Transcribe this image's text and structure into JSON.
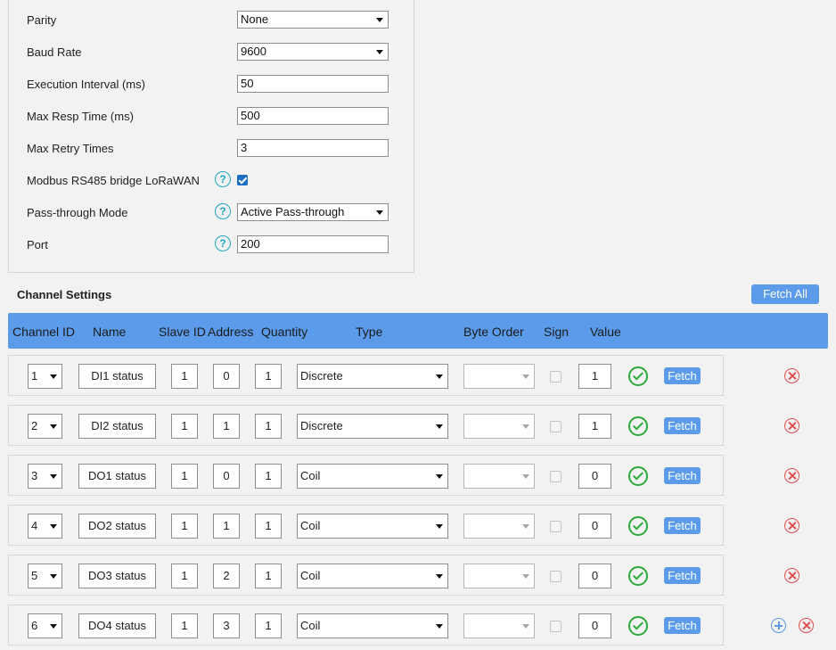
{
  "form": {
    "parity": {
      "label": "Parity",
      "value": "None"
    },
    "baud_rate": {
      "label": "Baud Rate",
      "value": "9600"
    },
    "execution_interval": {
      "label": "Execution Interval (ms)",
      "value": "50"
    },
    "max_resp_time": {
      "label": "Max Resp Time (ms)",
      "value": "500"
    },
    "max_retry_times": {
      "label": "Max Retry Times",
      "value": "3"
    },
    "bridge_lorawan": {
      "label": "Modbus RS485 bridge LoRaWAN",
      "checked": true
    },
    "pass_through_mode": {
      "label": "Pass-through Mode",
      "value": "Active Pass-through"
    },
    "port": {
      "label": "Port",
      "value": "200"
    },
    "help_glyph": "?"
  },
  "channel_settings": {
    "title": "Channel Settings",
    "fetch_all_label": "Fetch All",
    "fetch_label": "Fetch",
    "columns": [
      "Channel ID",
      "Name",
      "Slave ID",
      "Address",
      "Quantity",
      "Type",
      "Byte Order",
      "Sign",
      "Value"
    ],
    "rows": [
      {
        "channel_id": "1",
        "name": "DI1 status",
        "slave_id": "1",
        "address": "0",
        "quantity": "1",
        "type": "Discrete",
        "byte_order": "",
        "sign": false,
        "value": "1"
      },
      {
        "channel_id": "2",
        "name": "DI2 status",
        "slave_id": "1",
        "address": "1",
        "quantity": "1",
        "type": "Discrete",
        "byte_order": "",
        "sign": false,
        "value": "1"
      },
      {
        "channel_id": "3",
        "name": "DO1 status",
        "slave_id": "1",
        "address": "0",
        "quantity": "1",
        "type": "Coil",
        "byte_order": "",
        "sign": false,
        "value": "0"
      },
      {
        "channel_id": "4",
        "name": "DO2 status",
        "slave_id": "1",
        "address": "1",
        "quantity": "1",
        "type": "Coil",
        "byte_order": "",
        "sign": false,
        "value": "0"
      },
      {
        "channel_id": "5",
        "name": "DO3 status",
        "slave_id": "1",
        "address": "2",
        "quantity": "1",
        "type": "Coil",
        "byte_order": "",
        "sign": false,
        "value": "0"
      },
      {
        "channel_id": "6",
        "name": "DO4 status",
        "slave_id": "1",
        "address": "3",
        "quantity": "1",
        "type": "Coil",
        "byte_order": "",
        "sign": false,
        "value": "0"
      }
    ]
  },
  "colors": {
    "accent": "#5b9bea",
    "help": "#1aa7c0",
    "success": "#2eaa3a",
    "danger": "#e04b4b"
  },
  "icons": {
    "status": "check-circle-icon",
    "delete": "close-circle-icon",
    "add": "plus-circle-icon",
    "help": "help-icon"
  }
}
